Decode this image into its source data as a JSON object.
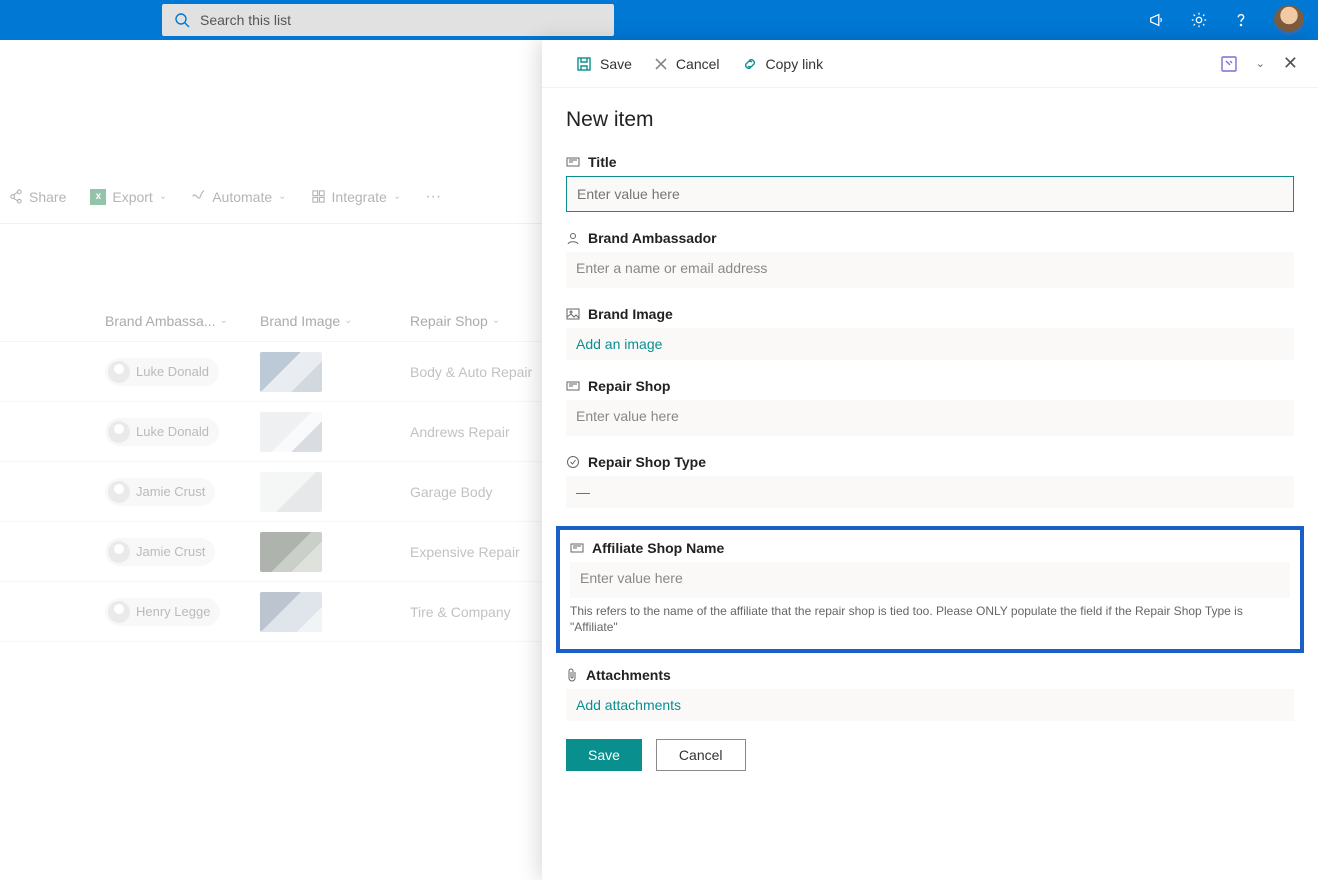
{
  "header": {
    "search_placeholder": "Search this list"
  },
  "cmd_bar": {
    "share": "Share",
    "export": "Export",
    "automate": "Automate",
    "integrate": "Integrate"
  },
  "table": {
    "cols": {
      "ba": "Brand Ambassa...",
      "bi": "Brand Image",
      "rs": "Repair Shop"
    },
    "rows": [
      {
        "person": "Luke Donald",
        "shop": "Body & Auto Repair"
      },
      {
        "person": "Luke Donald",
        "shop": "Andrews Repair"
      },
      {
        "person": "Jamie Crust",
        "shop": "Garage Body"
      },
      {
        "person": "Jamie Crust",
        "shop": "Expensive Repair"
      },
      {
        "person": "Henry Legge",
        "shop": "Tire & Company"
      }
    ]
  },
  "panel": {
    "save": "Save",
    "cancel": "Cancel",
    "copy_link": "Copy link",
    "title": "New item",
    "fields": {
      "title": {
        "label": "Title",
        "placeholder": "Enter value here"
      },
      "brand_ambassador": {
        "label": "Brand Ambassador",
        "placeholder": "Enter a name or email address"
      },
      "brand_image": {
        "label": "Brand Image",
        "link": "Add an image"
      },
      "repair_shop": {
        "label": "Repair Shop",
        "placeholder": "Enter value here"
      },
      "repair_shop_type": {
        "label": "Repair Shop Type",
        "value": "—"
      },
      "affiliate": {
        "label": "Affiliate Shop Name",
        "placeholder": "Enter value here",
        "hint": "This refers to the name of the affiliate that the repair shop is tied too. Please ONLY populate the field if the Repair Shop Type is \"Affiliate\""
      },
      "attachments": {
        "label": "Attachments",
        "link": "Add attachments"
      }
    },
    "buttons": {
      "save": "Save",
      "cancel": "Cancel"
    }
  }
}
